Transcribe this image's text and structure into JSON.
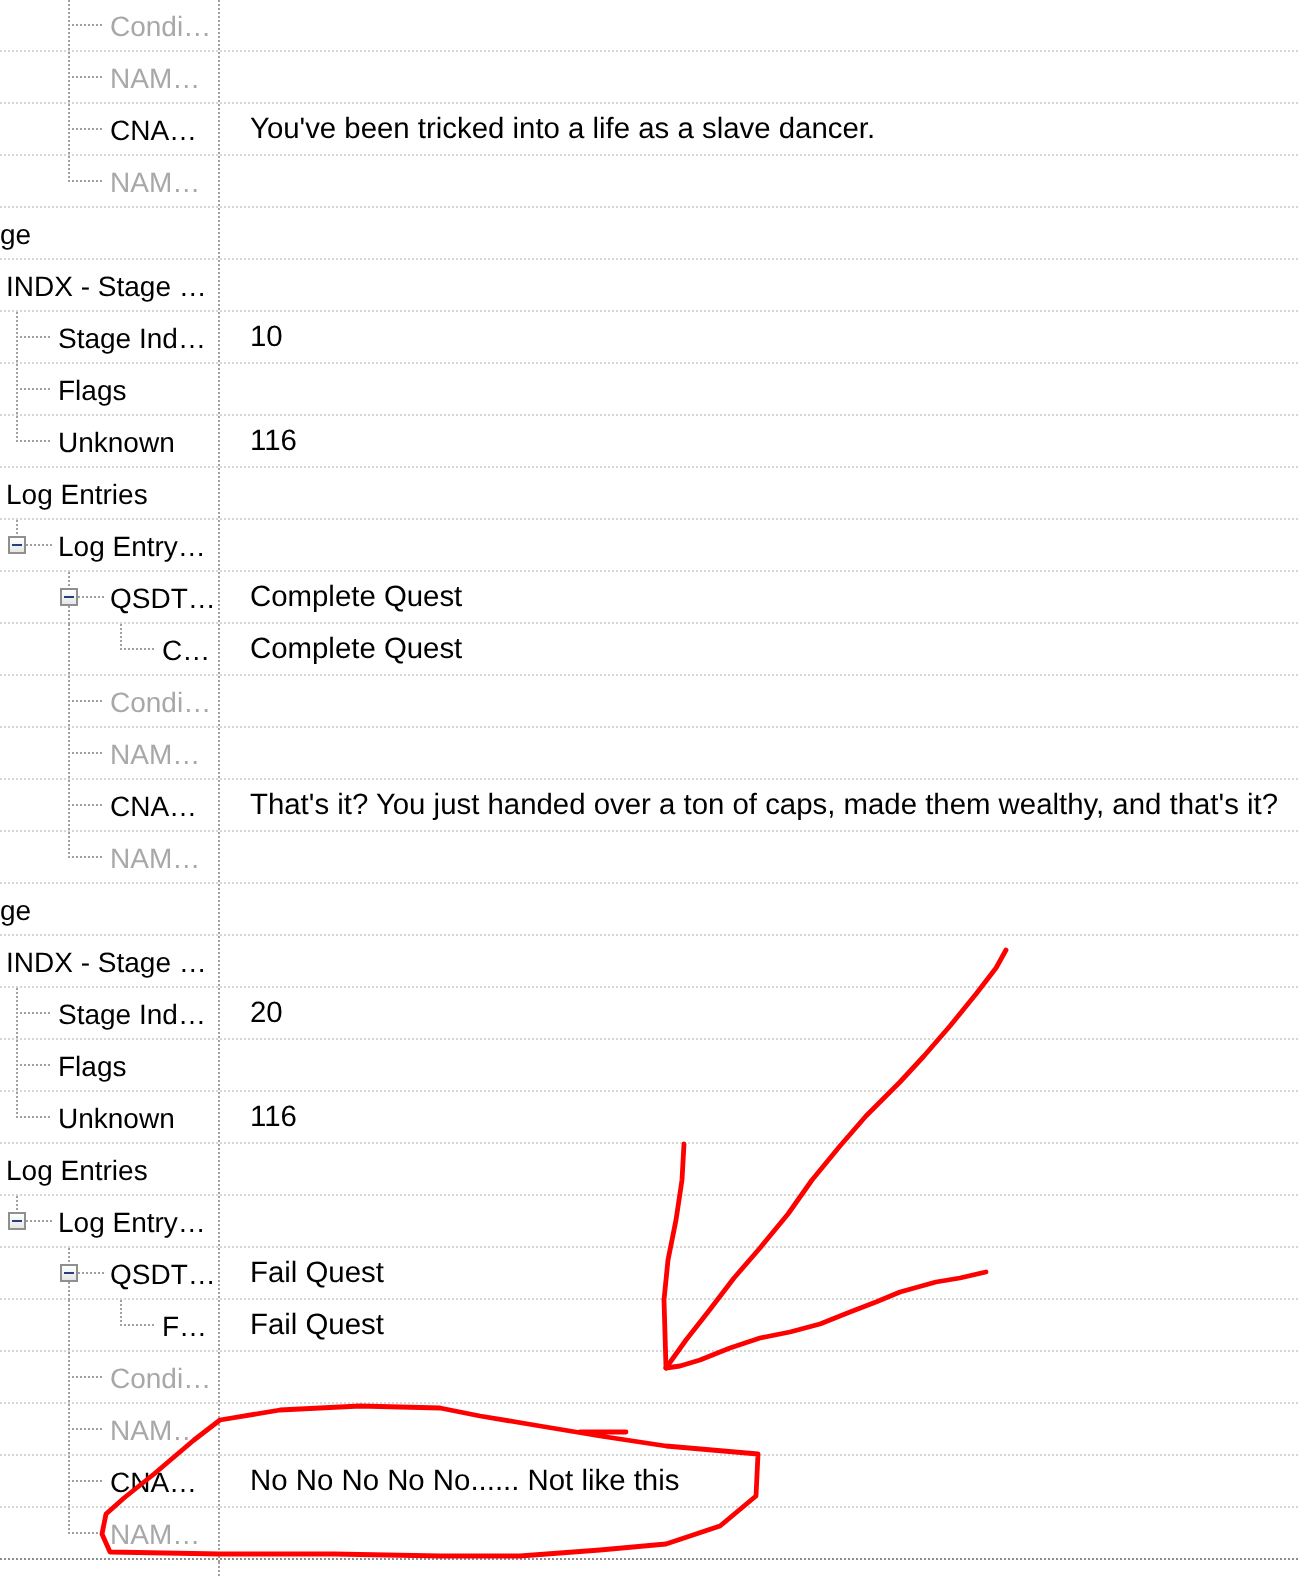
{
  "tree": {
    "nodes": [
      {
        "children": [
          {
            "children": [
              {
                "children": [
                  {
                    "label": "Condi…",
                    "disabled": true
                  },
                  {
                    "label": "NAM…",
                    "disabled": true
                  },
                  {
                    "label": "CNA…",
                    "disabled": false,
                    "value": "You've been tricked into a life as a slave dancer."
                  },
                  {
                    "label": "NAM…",
                    "disabled": true
                  }
                ]
              }
            ]
          }
        ]
      },
      {
        "label": "ge",
        "disabled": false,
        "children": [
          {
            "label": "INDX - Stage …",
            "disabled": false,
            "children": [
              {
                "label": "Stage Ind…",
                "disabled": false,
                "value": "10"
              },
              {
                "label": "Flags",
                "disabled": false
              },
              {
                "label": "Unknown",
                "disabled": false,
                "value": "116"
              }
            ]
          },
          {
            "label": "Log Entries",
            "disabled": false,
            "children": [
              {
                "label": "Log Entry…",
                "disabled": false,
                "expanded": true,
                "children": [
                  {
                    "label": "QSDT…",
                    "disabled": false,
                    "expanded": true,
                    "value": "Complete Quest",
                    "children": [
                      {
                        "label": "C…",
                        "disabled": false,
                        "value": "Complete Quest"
                      }
                    ]
                  },
                  {
                    "label": "Condi…",
                    "disabled": true
                  },
                  {
                    "label": "NAM…",
                    "disabled": true
                  },
                  {
                    "label": "CNA…",
                    "disabled": false,
                    "value": "That's it? You just handed over a ton of caps, made them wealthy, and that's it?"
                  },
                  {
                    "label": "NAM…",
                    "disabled": true
                  }
                ]
              }
            ]
          }
        ]
      },
      {
        "label": "ge",
        "disabled": false,
        "children": [
          {
            "label": "INDX - Stage …",
            "disabled": false,
            "children": [
              {
                "label": "Stage Ind…",
                "disabled": false,
                "value": "20"
              },
              {
                "label": "Flags",
                "disabled": false
              },
              {
                "label": "Unknown",
                "disabled": false,
                "value": "116"
              }
            ]
          },
          {
            "label": "Log Entries",
            "disabled": false,
            "children": [
              {
                "label": "Log Entry…",
                "disabled": false,
                "expanded": true,
                "children": [
                  {
                    "label": "QSDT…",
                    "disabled": false,
                    "expanded": true,
                    "value": "Fail Quest",
                    "children": [
                      {
                        "label": "F…",
                        "disabled": false,
                        "value": "Fail Quest"
                      }
                    ]
                  },
                  {
                    "label": "Condi…",
                    "disabled": true
                  },
                  {
                    "label": "NAM…",
                    "disabled": true
                  },
                  {
                    "label": "CNA…",
                    "disabled": false,
                    "value": "No No No No No...... Not like this"
                  },
                  {
                    "label": "NAM…",
                    "disabled": true
                  }
                ]
              }
            ]
          }
        ]
      }
    ]
  }
}
